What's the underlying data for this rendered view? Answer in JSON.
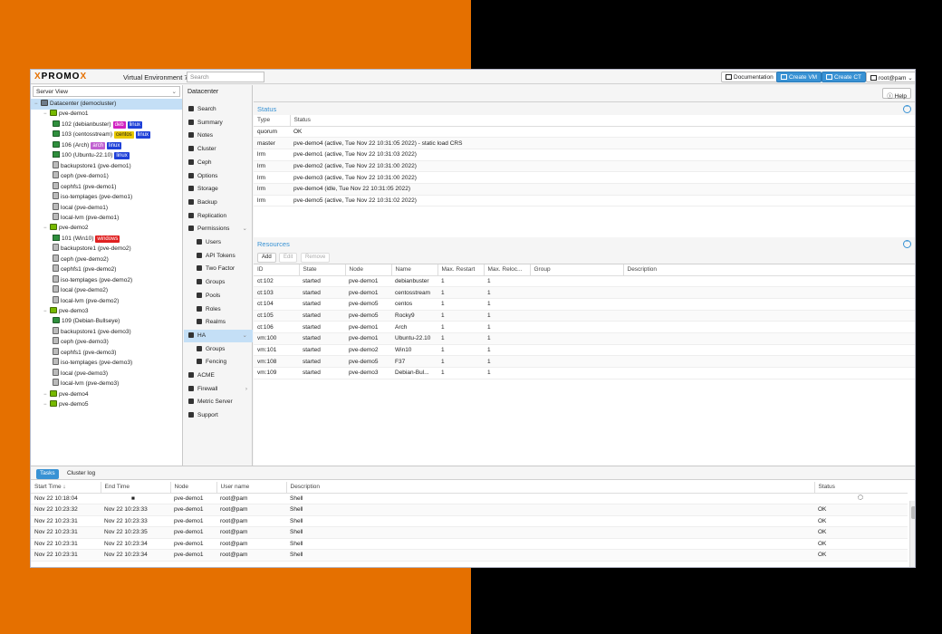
{
  "header": {
    "logo_pro": "PRO",
    "logo_x": "X",
    "logo_mo": "MO",
    "logo_x2": "X",
    "version": "Virtual Environment 7.3-3",
    "search_placeholder": "Search",
    "documentation": "Documentation",
    "create_vm": "Create VM",
    "create_ct": "Create CT",
    "user": "root@pam"
  },
  "tree": {
    "view": "Server View",
    "rows": [
      {
        "label": "Datacenter (democluster)",
        "icon": "datacenter-icon"
      },
      {
        "label": "pve-demo1",
        "icon": "node-icon"
      },
      {
        "label": "102 (debianbuster)",
        "icon": "container-icon",
        "tags": [
          "deb",
          "linux"
        ]
      },
      {
        "label": "103 (centosstream)",
        "icon": "container-icon",
        "tags": [
          "centos",
          "linux"
        ]
      },
      {
        "label": "106 (Arch)",
        "icon": "container-icon",
        "tags": [
          "arch",
          "linux"
        ]
      },
      {
        "label": "100 (Ubuntu-22.10)",
        "icon": "vm-icon",
        "tags": [
          "linux"
        ]
      },
      {
        "label": "backupstore1 (pve-demo1)",
        "icon": "storage-icon"
      },
      {
        "label": "ceph (pve-demo1)",
        "icon": "storage-icon"
      },
      {
        "label": "cephfs1 (pve-demo1)",
        "icon": "storage-icon"
      },
      {
        "label": "iso-templages (pve-demo1)",
        "icon": "storage-icon"
      },
      {
        "label": "local (pve-demo1)",
        "icon": "storage-icon"
      },
      {
        "label": "local-lvm (pve-demo1)",
        "icon": "storage-icon"
      },
      {
        "label": "pve-demo2",
        "icon": "node-icon"
      },
      {
        "label": "101 (Win10)",
        "icon": "vm-icon",
        "tags": [
          "windows"
        ]
      },
      {
        "label": "backupstore1 (pve-demo2)",
        "icon": "storage-icon"
      },
      {
        "label": "ceph (pve-demo2)",
        "icon": "storage-icon"
      },
      {
        "label": "cephfs1 (pve-demo2)",
        "icon": "storage-icon"
      },
      {
        "label": "iso-templages (pve-demo2)",
        "icon": "storage-icon"
      },
      {
        "label": "local (pve-demo2)",
        "icon": "storage-icon"
      },
      {
        "label": "local-lvm (pve-demo2)",
        "icon": "storage-icon"
      },
      {
        "label": "pve-demo3",
        "icon": "node-icon"
      },
      {
        "label": "109 (Debian-Bullseye)",
        "icon": "container-icon"
      },
      {
        "label": "backupstore1 (pve-demo3)",
        "icon": "storage-icon"
      },
      {
        "label": "ceph (pve-demo3)",
        "icon": "storage-icon"
      },
      {
        "label": "cephfs1 (pve-demo3)",
        "icon": "storage-icon"
      },
      {
        "label": "iso-templages (pve-demo3)",
        "icon": "storage-icon"
      },
      {
        "label": "local (pve-demo3)",
        "icon": "storage-icon"
      },
      {
        "label": "local-lvm (pve-demo3)",
        "icon": "storage-icon"
      },
      {
        "label": "pve-demo4",
        "icon": "node-icon"
      },
      {
        "label": "pve-demo5",
        "icon": "node-icon"
      }
    ],
    "tag_colors": {
      "deb": "#d020c0",
      "linux": "#1e40d8",
      "centos": "#e8c800",
      "arch": "#c060d0",
      "windows": "#e02020"
    }
  },
  "nav": {
    "title": "Datacenter",
    "items": [
      {
        "label": "Search"
      },
      {
        "label": "Summary"
      },
      {
        "label": "Notes"
      },
      {
        "label": "Cluster"
      },
      {
        "label": "Ceph"
      },
      {
        "label": "Options"
      },
      {
        "label": "Storage"
      },
      {
        "label": "Backup"
      },
      {
        "label": "Replication"
      },
      {
        "label": "Permissions"
      },
      {
        "label": "Users"
      },
      {
        "label": "API Tokens"
      },
      {
        "label": "Two Factor"
      },
      {
        "label": "Groups"
      },
      {
        "label": "Pools"
      },
      {
        "label": "Roles"
      },
      {
        "label": "Realms"
      },
      {
        "label": "HA"
      },
      {
        "label": "Groups"
      },
      {
        "label": "Fencing"
      },
      {
        "label": "ACME"
      },
      {
        "label": "Firewall"
      },
      {
        "label": "Metric Server"
      },
      {
        "label": "Support"
      }
    ]
  },
  "content": {
    "help": "Help",
    "status_title": "Status",
    "status_cols": [
      "Type",
      "Status"
    ],
    "status_rows": [
      [
        "quorum",
        "OK"
      ],
      [
        "master",
        "pve-demo4 (active, Tue Nov 22 10:31:05 2022) - static load CRS"
      ],
      [
        "lrm",
        "pve-demo1 (active, Tue Nov 22 10:31:03 2022)"
      ],
      [
        "lrm",
        "pve-demo2 (active, Tue Nov 22 10:31:00 2022)"
      ],
      [
        "lrm",
        "pve-demo3 (active, Tue Nov 22 10:31:00 2022)"
      ],
      [
        "lrm",
        "pve-demo4 (idle, Tue Nov 22 10:31:05 2022)"
      ],
      [
        "lrm",
        "pve-demo5 (active, Tue Nov 22 10:31:02 2022)"
      ]
    ],
    "resources_title": "Resources",
    "add": "Add",
    "edit": "Edit",
    "remove": "Remove",
    "res_cols": [
      "ID",
      "State",
      "Node",
      "Name",
      "Max. Restart",
      "Max. Reloc...",
      "Group",
      "Description"
    ],
    "res_rows": [
      [
        "ct:102",
        "started",
        "pve-demo1",
        "debianbuster",
        "1",
        "1",
        "",
        ""
      ],
      [
        "ct:103",
        "started",
        "pve-demo1",
        "centosstream",
        "1",
        "1",
        "",
        ""
      ],
      [
        "ct:104",
        "started",
        "pve-demo5",
        "centos",
        "1",
        "1",
        "",
        ""
      ],
      [
        "ct:105",
        "started",
        "pve-demo5",
        "Rocky9",
        "1",
        "1",
        "",
        ""
      ],
      [
        "ct:106",
        "started",
        "pve-demo1",
        "Arch",
        "1",
        "1",
        "",
        ""
      ],
      [
        "vm:100",
        "started",
        "pve-demo1",
        "Ubuntu-22.10",
        "1",
        "1",
        "",
        ""
      ],
      [
        "vm:101",
        "started",
        "pve-demo2",
        "Win10",
        "1",
        "1",
        "",
        ""
      ],
      [
        "vm:108",
        "started",
        "pve-demo5",
        "F37",
        "1",
        "1",
        "",
        ""
      ],
      [
        "vm:109",
        "started",
        "pve-demo3",
        "Debian-Bul...",
        "1",
        "1",
        "",
        ""
      ]
    ]
  },
  "tasks": {
    "tab_tasks": "Tasks",
    "tab_cluster_log": "Cluster log",
    "cols": [
      "Start Time ↓",
      "End Time",
      "Node",
      "User name",
      "Description",
      "Status"
    ],
    "rows": [
      [
        "Nov 22 10:18:04",
        "",
        "pve-demo1",
        "root@pam",
        "Shell",
        ""
      ],
      [
        "Nov 22 10:23:32",
        "Nov 22 10:23:33",
        "pve-demo1",
        "root@pam",
        "Shell",
        "OK"
      ],
      [
        "Nov 22 10:23:31",
        "Nov 22 10:23:33",
        "pve-demo1",
        "root@pam",
        "Shell",
        "OK"
      ],
      [
        "Nov 22 10:23:31",
        "Nov 22 10:23:35",
        "pve-demo1",
        "root@pam",
        "Shell",
        "OK"
      ],
      [
        "Nov 22 10:23:31",
        "Nov 22 10:23:34",
        "pve-demo1",
        "root@pam",
        "Shell",
        "OK"
      ],
      [
        "Nov 22 10:23:31",
        "Nov 22 10:23:34",
        "pve-demo1",
        "root@pam",
        "Shell",
        "OK"
      ]
    ]
  }
}
